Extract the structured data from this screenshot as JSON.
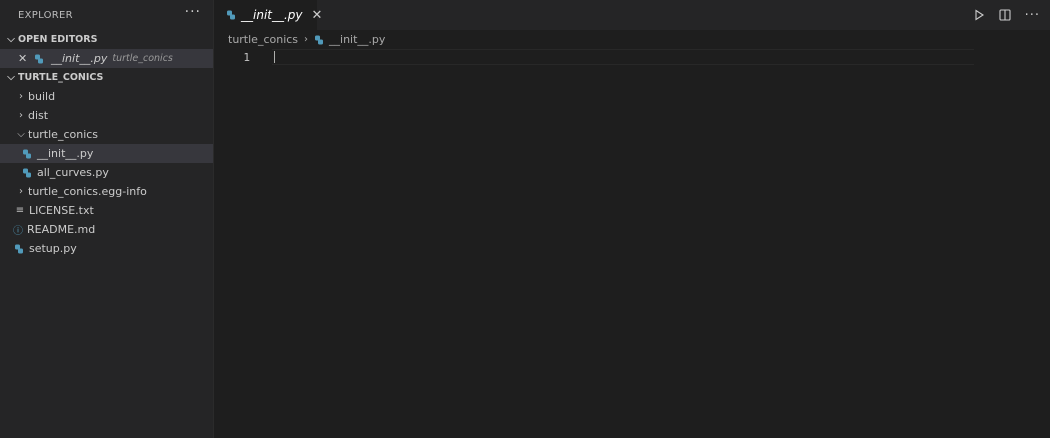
{
  "sidebar": {
    "title": "EXPLORER",
    "more_label": "···",
    "open_editors": {
      "header": "OPEN EDITORS",
      "item": {
        "name": "__init__.py",
        "description": "turtle_conics"
      }
    },
    "workspace": {
      "header": "TURTLE_CONICS",
      "items": [
        {
          "name": "build"
        },
        {
          "name": "dist"
        },
        {
          "name": "turtle_conics"
        },
        {
          "name": "__init__.py"
        },
        {
          "name": "all_curves.py"
        },
        {
          "name": "turtle_conics.egg-info"
        },
        {
          "name": "LICENSE.txt"
        },
        {
          "name": "README.md"
        },
        {
          "name": "setup.py"
        }
      ]
    }
  },
  "editor": {
    "tab": {
      "label": "__init__.py"
    },
    "breadcrumb": {
      "folder": "turtle_conics",
      "file": "__init__.py"
    },
    "line_number": "1"
  },
  "colors": {
    "python_blue": "#519aba",
    "python_yellow": "#e8c94a",
    "selection": "#37373d"
  }
}
